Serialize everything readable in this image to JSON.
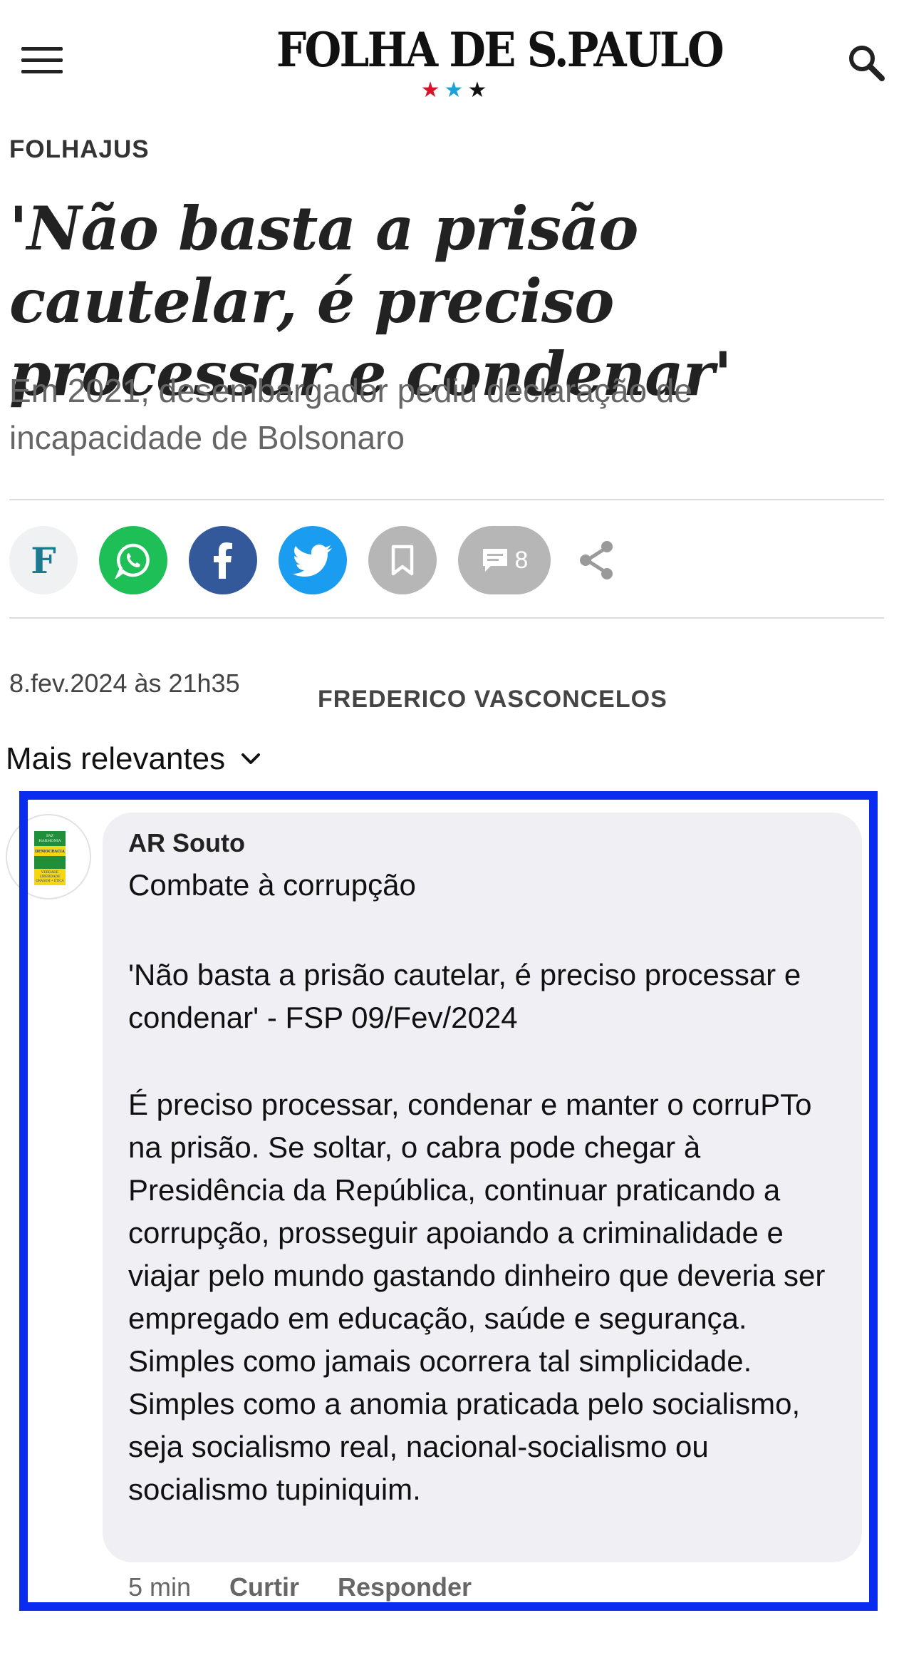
{
  "header": {
    "logo": "FOLHA DE S.PAULO",
    "stars": [
      "★",
      "★",
      "★"
    ]
  },
  "article": {
    "section": "FOLHAJUS",
    "headline": "'Não basta a prisão cautelar, é preciso processar e condenar'",
    "subheadline": "Em 2021, desembargador pediu declaração de incapacidade de Bolsonaro",
    "date": "8.fev.2024 às 21h35",
    "author": "FREDERICO VASCONCELOS"
  },
  "share": {
    "folha_letter": "F",
    "comments_count": "8"
  },
  "comments": {
    "sort_label": "Mais relevantes",
    "item": {
      "author": "AR Souto",
      "title": "Combate à corrupção",
      "quote": "'Não basta a prisão cautelar, é preciso processar e condenar' - FSP 09/Fev/2024",
      "body": "É preciso processar, condenar e manter o corruPTo na prisão. Se soltar, o cabra pode chegar à Presidência da República, continuar praticando a corrupção, prosseguir apoiando a criminalidade e viajar pelo mundo gastando dinheiro que deveria ser empregado em educação, saúde e segurança. Simples como jamais ocorrera tal simplicidade. Simples como a anomia praticada pelo socialismo, seja socialismo real, nacional-socialismo ou socialismo tupiniquim.",
      "time": "5 min",
      "like_label": "Curtir",
      "reply_label": "Responder",
      "avatar_words": [
        "PAZ",
        "HARMONIA",
        "DEMOCRACIA",
        "VERDADE",
        "LIBERDADE",
        "ORAGEM • ÉTICA"
      ]
    }
  },
  "colors": {
    "highlight_border": "#0a2cf0",
    "whatsapp": "#1fbf57",
    "facebook": "#34599b",
    "twitter": "#1a9df0"
  }
}
